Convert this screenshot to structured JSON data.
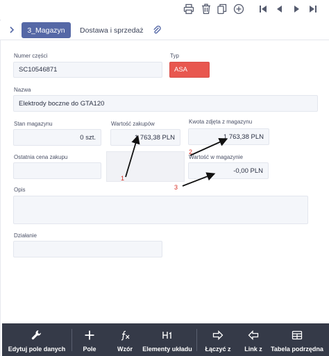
{
  "toolbar": {
    "icons": [
      "printer-icon",
      "trash-icon",
      "copy-icon",
      "add-circle-icon",
      "first-page-icon",
      "previous-icon",
      "next-icon",
      "last-page-icon"
    ]
  },
  "tabs": {
    "active_label": "3_Magazyn",
    "items": [
      "Dostawa i sprzedaż"
    ]
  },
  "form": {
    "numer_czesci": {
      "label": "Numer części",
      "value": "SC10546871"
    },
    "typ": {
      "label": "Typ",
      "value": "ASA",
      "color": "#e8574f"
    },
    "nazwa": {
      "label": "Nazwa",
      "value": "Elektrody boczne do GTA120"
    },
    "stan_magazynu": {
      "label": "Stan magazynu",
      "value": "0 szt."
    },
    "wartosc_zakupow": {
      "label": "Wartość zakupów",
      "value": "1 763,38 PLN"
    },
    "kwota_zdjeta": {
      "label": "Kwota zdjęta z magazynu",
      "value": "1 763,38 PLN"
    },
    "ostatnia_cena": {
      "label": "Ostatnia cena zakupu",
      "value": ""
    },
    "wartosc_w_magazynie": {
      "label": "Wartość w magazynie",
      "value": "-0,00 PLN"
    },
    "opis": {
      "label": "Opis",
      "value": ""
    },
    "dzialanie": {
      "label": "Działanie",
      "value": ""
    }
  },
  "annotations": [
    "1",
    "2",
    "3"
  ],
  "bottom_bar": {
    "items": [
      {
        "label": "Edytuj pole danych",
        "icon": "wrench-icon"
      },
      {
        "label": "Pole",
        "icon": "plus-icon"
      },
      {
        "label": "Wzór",
        "icon": "function-icon"
      },
      {
        "label": "Elementy układu",
        "icon": "heading-icon"
      },
      {
        "label": "Łączyć z",
        "icon": "arrow-right-icon"
      },
      {
        "label": "Link z",
        "icon": "arrow-left-icon"
      },
      {
        "label": "Tabela podrzędna",
        "icon": "table-icon"
      }
    ],
    "background": "#353a48"
  }
}
